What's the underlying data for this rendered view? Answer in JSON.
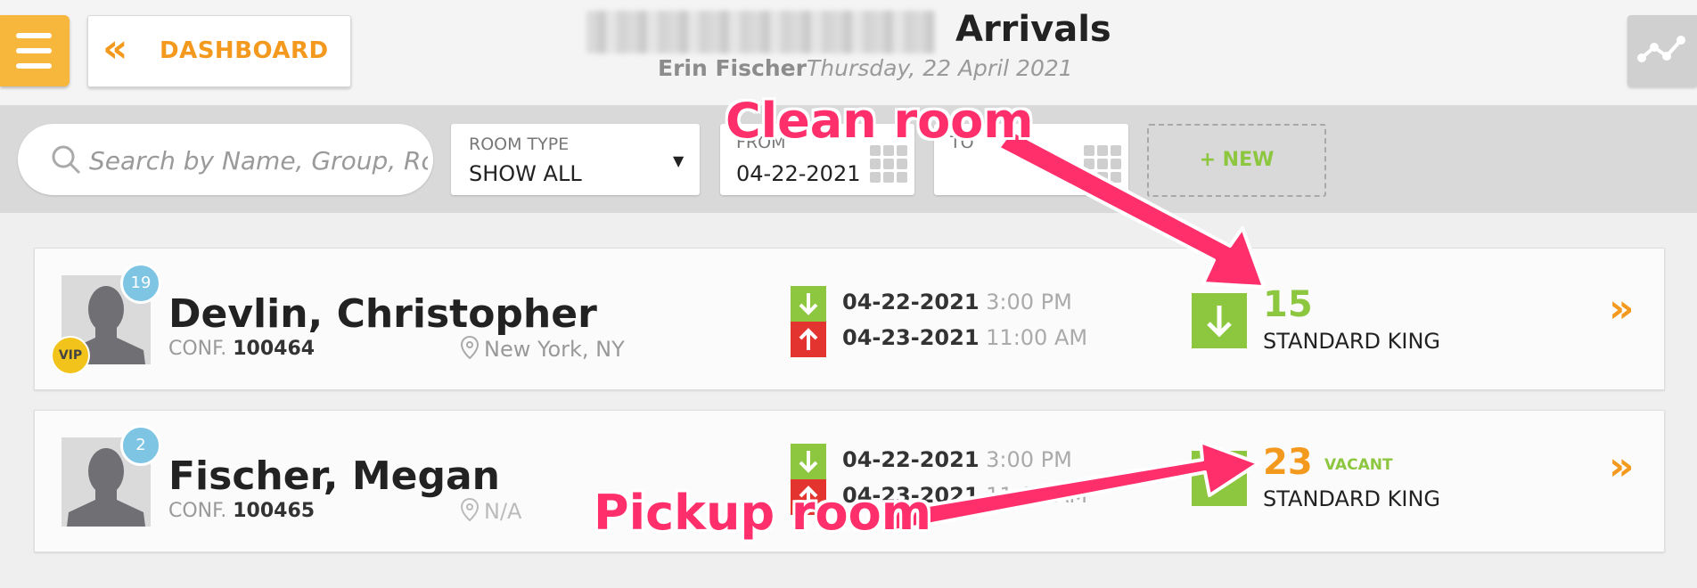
{
  "header": {
    "dashboard_label": "DASHBOARD",
    "title": "Arrivals",
    "user": "Erin Fischer",
    "date": "Thursday, 22 April 2021"
  },
  "filters": {
    "search_placeholder": "Search by Name, Group, Roo",
    "room_type_caption": "ROOM TYPE",
    "room_type_value": "SHOW ALL",
    "from_caption": "FROM",
    "from_value": "04-22-2021",
    "to_caption": "TO",
    "to_value": "",
    "new_label": "+ NEW"
  },
  "guests": [
    {
      "name": "Devlin, Christopher",
      "conf_label": "CONF.",
      "conf": "100464",
      "badge": "19",
      "vip": "VIP",
      "location": "New York, NY",
      "arrival_date": "04-22-2021",
      "arrival_time": "3:00 PM",
      "departure_date": "04-23-2021",
      "departure_time": "11:00 AM",
      "room_number": "15",
      "room_type": "STANDARD KING",
      "room_status": ""
    },
    {
      "name": "Fischer, Megan",
      "conf_label": "CONF.",
      "conf": "100465",
      "badge": "2",
      "location": "N/A",
      "arrival_date": "04-22-2021",
      "arrival_time": "3:00 PM",
      "departure_date": "04-23-2021",
      "departure_time": "11:00 AM",
      "room_number": "23",
      "room_type": "STANDARD KING",
      "room_status": "VACANT"
    }
  ],
  "annotations": {
    "clean": "Clean room",
    "pickup": "Pickup room"
  },
  "colors": {
    "accent": "#f39a1e",
    "green": "#8dc63f",
    "red": "#e3342f",
    "annotation": "#ff2f6c"
  }
}
